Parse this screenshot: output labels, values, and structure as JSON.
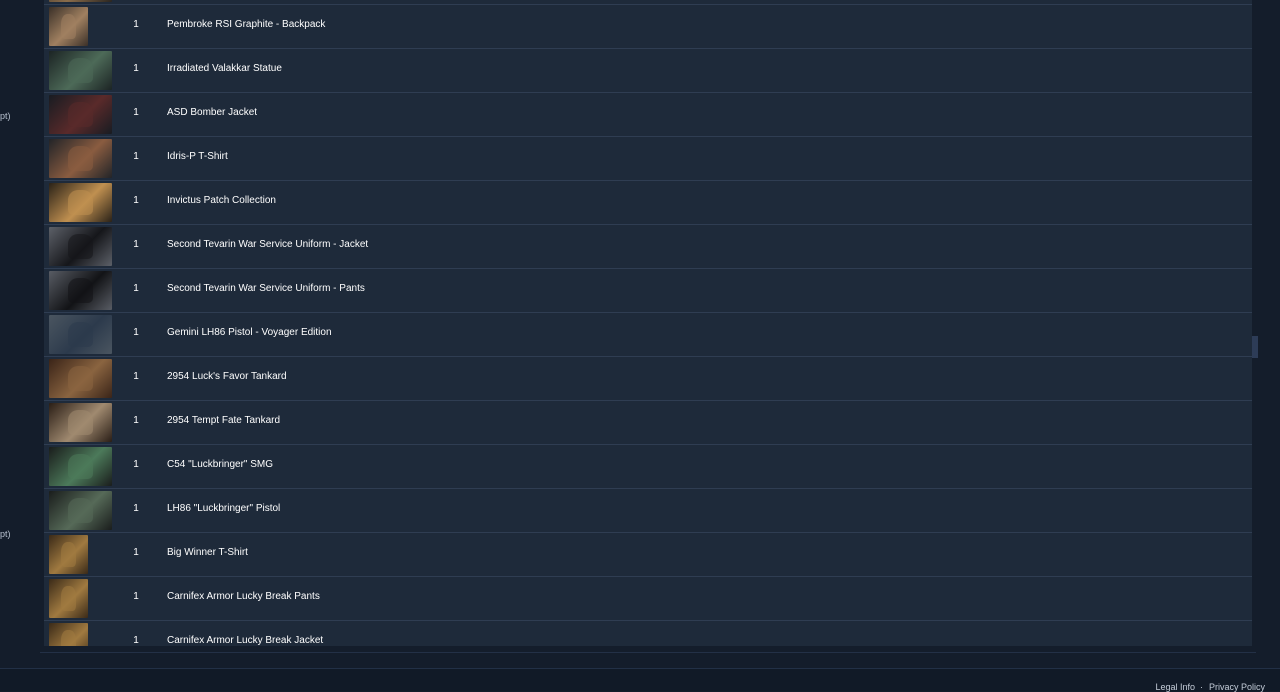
{
  "sidebar": {
    "fragments": [
      "pt)",
      "pt)"
    ]
  },
  "items": [
    {
      "qty": "1",
      "name": "Pembroke RSI Graphite - Backpack",
      "thumb": "wide",
      "colors": [
        "#2a2520",
        "#8a6c4a"
      ]
    },
    {
      "qty": "1",
      "name": "Pembroke RSI Graphite - Backpack",
      "thumb": "narrow",
      "colors": [
        "#3a3028",
        "#a08060"
      ]
    },
    {
      "qty": "1",
      "name": "Irradiated Valakkar Statue",
      "thumb": "wide",
      "colors": [
        "#1c2424",
        "#4d6a58"
      ]
    },
    {
      "qty": "1",
      "name": "ASD Bomber Jacket",
      "thumb": "wide",
      "colors": [
        "#181c22",
        "#5a2a2a"
      ]
    },
    {
      "qty": "1",
      "name": "Idris-P T-Shirt",
      "thumb": "wide",
      "colors": [
        "#222428",
        "#8a5c40"
      ]
    },
    {
      "qty": "1",
      "name": "Invictus Patch Collection",
      "thumb": "wide",
      "colors": [
        "#2a2218",
        "#c09050"
      ]
    },
    {
      "qty": "1",
      "name": "Second Tevarin War Service Uniform - Jacket",
      "thumb": "wide",
      "colors": [
        "#5c6068",
        "#15161a"
      ]
    },
    {
      "qty": "1",
      "name": "Second Tevarin War Service Uniform - Pants",
      "thumb": "wide",
      "colors": [
        "#585c64",
        "#121316"
      ]
    },
    {
      "qty": "1",
      "name": "Gemini LH86 Pistol - Voyager Edition",
      "thumb": "wide",
      "colors": [
        "#4a5560",
        "#2c3a4c"
      ]
    },
    {
      "qty": "1",
      "name": "2954 Luck's Favor Tankard",
      "thumb": "wide",
      "colors": [
        "#3a2418",
        "#8a6440"
      ]
    },
    {
      "qty": "1",
      "name": "2954 Tempt Fate Tankard",
      "thumb": "wide",
      "colors": [
        "#2a1e16",
        "#a08a70"
      ]
    },
    {
      "qty": "1",
      "name": "C54 \"Luckbringer\" SMG",
      "thumb": "wide",
      "colors": [
        "#1a1d1c",
        "#4c7a5a"
      ]
    },
    {
      "qty": "1",
      "name": "LH86 \"Luckbringer\" Pistol",
      "thumb": "wide",
      "colors": [
        "#1a1d1c",
        "#566a58"
      ]
    },
    {
      "qty": "1",
      "name": "Big Winner T-Shirt",
      "thumb": "narrow",
      "colors": [
        "#3a2a18",
        "#a07a40"
      ]
    },
    {
      "qty": "1",
      "name": "Carnifex Armor Lucky Break Pants",
      "thumb": "narrow",
      "colors": [
        "#3a2a18",
        "#a07a40"
      ]
    },
    {
      "qty": "1",
      "name": "Carnifex Armor Lucky Break Jacket",
      "thumb": "narrow",
      "colors": [
        "#3a2a18",
        "#a07a40"
      ]
    }
  ],
  "footer": {
    "legal_label": "Legal Info",
    "privacy_label": "Privacy Policy"
  }
}
